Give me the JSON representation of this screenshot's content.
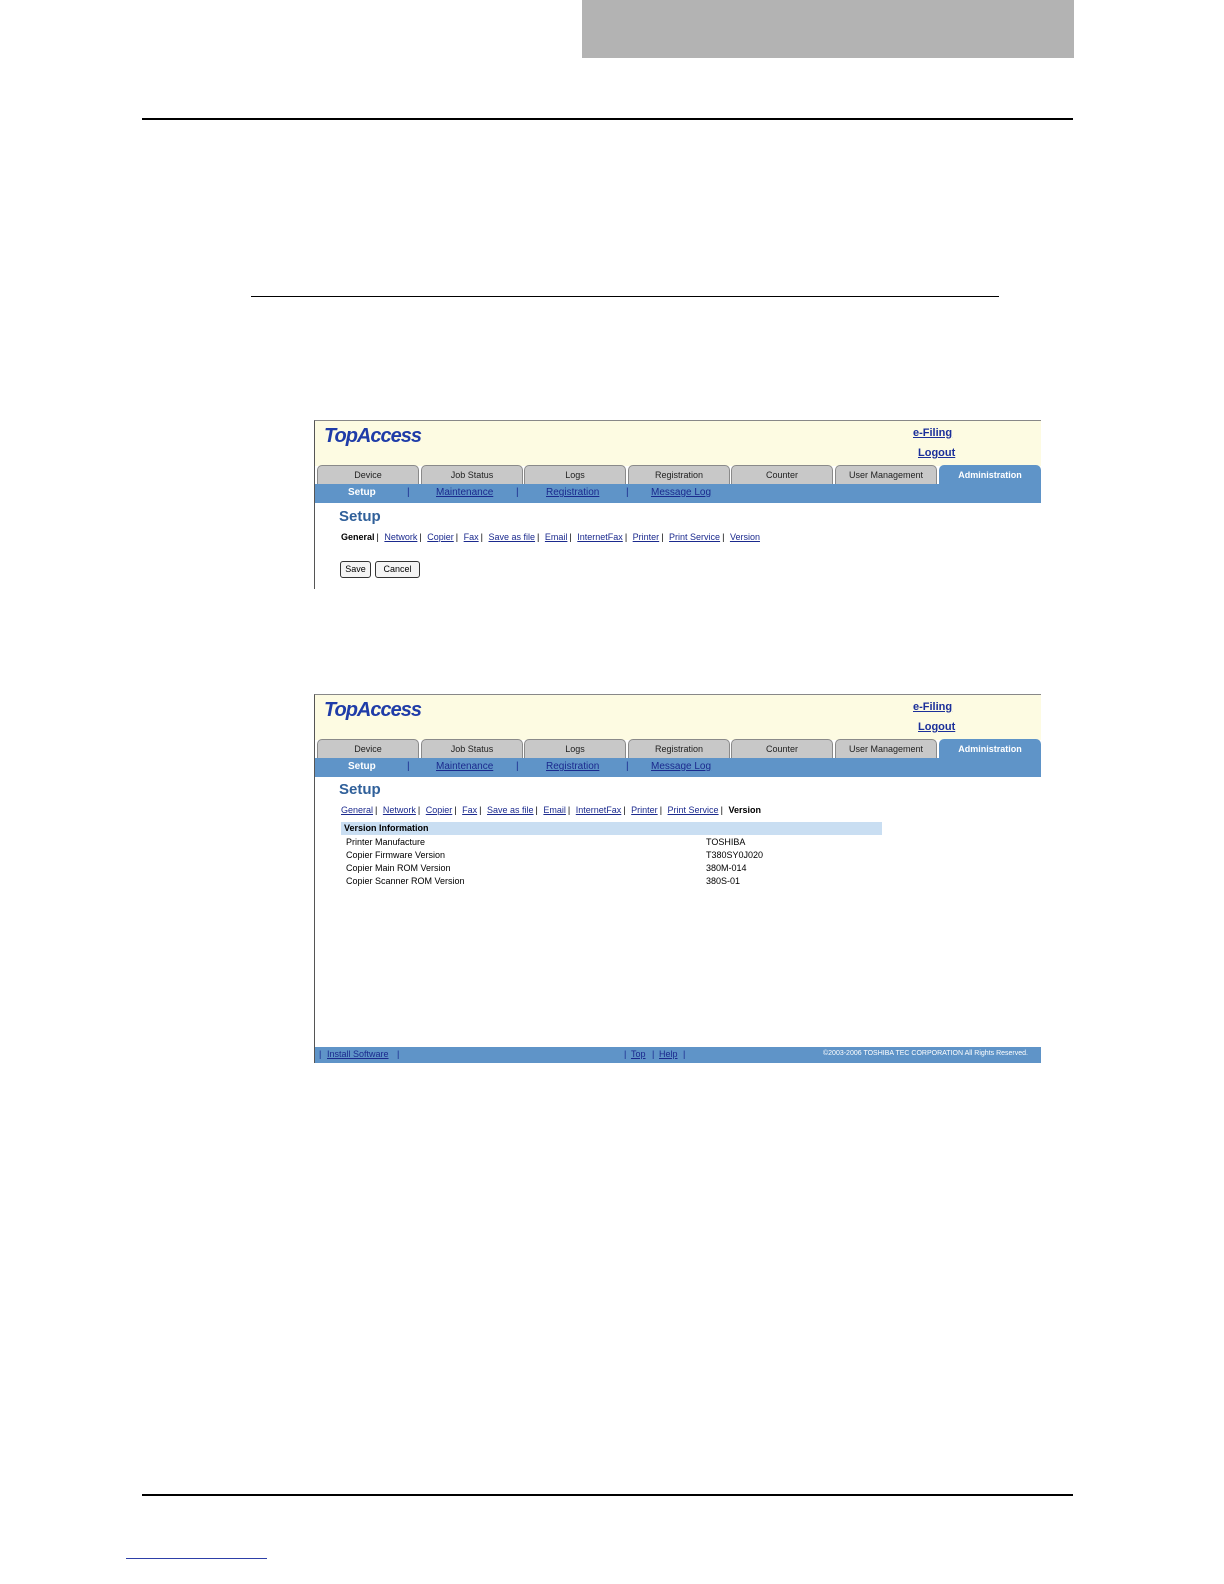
{
  "topaccess": {
    "logo": "TopAccess",
    "efiling_link": "e-Filing",
    "logout_link": "Logout",
    "tabs": [
      "Device",
      "Job Status",
      "Logs",
      "Registration",
      "Counter",
      "User Management",
      "Administration"
    ],
    "active_tab": "Administration",
    "subnav": {
      "current": "Setup",
      "links": [
        "Maintenance",
        "Registration",
        "Message Log"
      ],
      "separator": "|"
    },
    "page_title": "Setup",
    "setup_menu": [
      "General",
      "Network",
      "Copier",
      "Fax",
      "Save as file",
      "Email",
      "InternetFax",
      "Printer",
      "Print Service",
      "Version"
    ],
    "menu_separator": "|"
  },
  "screenshot1": {
    "active_menu_item": "General",
    "buttons": {
      "save": "Save",
      "cancel": "Cancel"
    }
  },
  "screenshot2": {
    "active_menu_item": "Version",
    "version_table": {
      "header": "Version Information",
      "rows": [
        {
          "label": "Printer Manufacture",
          "value": "TOSHIBA"
        },
        {
          "label": "Copier Firmware Version",
          "value": "T380SY0J020"
        },
        {
          "label": "Copier Main ROM Version",
          "value": "380M-014"
        },
        {
          "label": "Copier Scanner ROM Version",
          "value": "380S-01"
        }
      ]
    },
    "footer": {
      "install_software": "Install Software",
      "top": "Top",
      "help": "Help",
      "separator": "|",
      "copyright": "©2003-2006 TOSHIBA TEC CORPORATION All Rights Reserved."
    }
  },
  "colors": {
    "header_gray": "#b3b3b3",
    "topaccess_blue": "#5f94c8",
    "topaccess_header_bg": "#fdfbe2",
    "version_header_bg": "#c9def2",
    "link_blue": "#1b2a8e"
  }
}
